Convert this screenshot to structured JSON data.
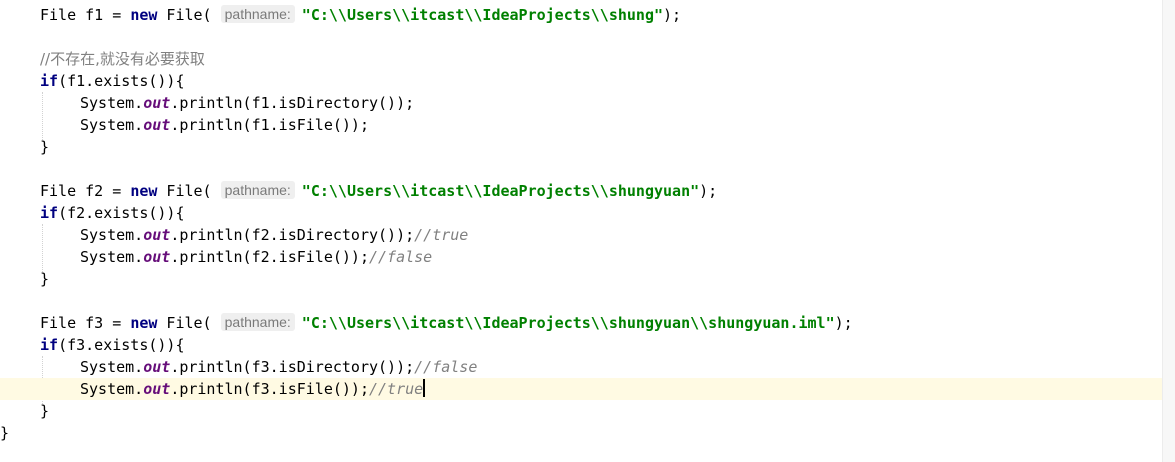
{
  "code": {
    "f1": {
      "decl_type": "File",
      "var": "f1",
      "assign": " = ",
      "kw_new": "new",
      "ctor_open": " File(",
      "hint": "pathname:",
      "path": "\"C:\\\\Users\\\\itcast\\\\IdeaProjects\\\\shung\"",
      "end": ");",
      "comment": "//不存在,就没有必要获取",
      "kw_if": "if",
      "cond": "(f1.exists()){",
      "l1_pre": "System.",
      "l1_out": "out",
      "l1_call": ".println(f1.isDirectory());",
      "l2_pre": "System.",
      "l2_out": "out",
      "l2_call": ".println(f1.isFile());",
      "close": "}"
    },
    "f2": {
      "decl_type": "File",
      "var": "f2",
      "assign": " = ",
      "kw_new": "new",
      "ctor_open": " File(",
      "hint": "pathname:",
      "path": "\"C:\\\\Users\\\\itcast\\\\IdeaProjects\\\\shungyuan\"",
      "end": ");",
      "kw_if": "if",
      "cond": "(f2.exists()){",
      "l1_pre": "System.",
      "l1_out": "out",
      "l1_call": ".println(f2.isDirectory());",
      "l1_comment": "//true",
      "l2_pre": "System.",
      "l2_out": "out",
      "l2_call": ".println(f2.isFile());",
      "l2_comment": "//false",
      "close": "}"
    },
    "f3": {
      "decl_type": "File",
      "var": "f3",
      "assign": " = ",
      "kw_new": "new",
      "ctor_open": " File(",
      "hint": "pathname:",
      "path": "\"C:\\\\Users\\\\itcast\\\\IdeaProjects\\\\shungyuan\\\\shungyuan.iml\"",
      "end": ");",
      "kw_if": "if",
      "cond": "(f3.exists()){",
      "l1_pre": "System.",
      "l1_out": "out",
      "l1_call": ".println(f3.isDirectory());",
      "l1_comment": "//false",
      "l2_pre": "System.",
      "l2_out": "out",
      "l2_call": ".println(f3.isFile());",
      "l2_comment": "//true",
      "close": "}"
    },
    "method_close": "}"
  }
}
